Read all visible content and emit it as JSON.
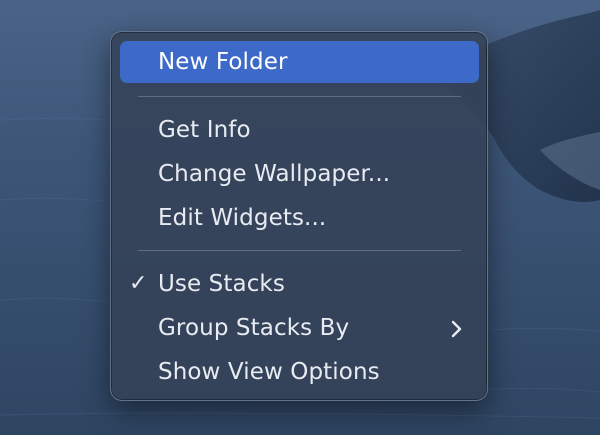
{
  "context_menu": {
    "items": [
      {
        "label": "New Folder",
        "highlighted": true
      },
      {
        "label": "Get Info"
      },
      {
        "label": "Change Wallpaper..."
      },
      {
        "label": "Edit Widgets..."
      },
      {
        "label": "Use Stacks",
        "checked": true,
        "check_glyph": "✓"
      },
      {
        "label": "Group Stacks By",
        "has_submenu": true
      },
      {
        "label": "Show View Options"
      }
    ]
  },
  "colors": {
    "highlight": "#3d69c8",
    "menu_background": "#344258",
    "text": "#e8ecf2",
    "wallpaper_sea": "#3b5374",
    "wallpaper_land": "#2a3d57"
  },
  "icons": {
    "check": "checkmark-icon",
    "submenu": "chevron-right-icon"
  }
}
